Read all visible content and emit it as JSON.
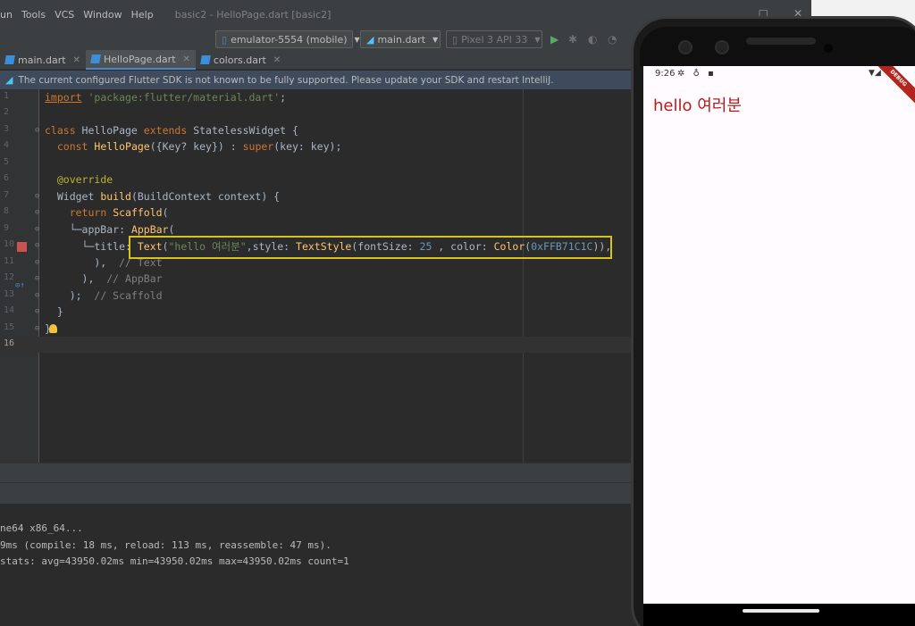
{
  "menubar": {
    "items": [
      "un",
      "Tools",
      "VCS",
      "Window",
      "Help"
    ],
    "title": "basic2 - HelloPage.dart [basic2]",
    "minimize_icon": "minimize-icon",
    "close_icon": "close-icon"
  },
  "toolbar": {
    "device_select": "emulator-5554 (mobile)",
    "config_select": "main.dart",
    "avd_select": "Pixel 3 API 33"
  },
  "tabs": [
    {
      "label": "main.dart"
    },
    {
      "label": "HelloPage.dart"
    },
    {
      "label": "colors.dart"
    }
  ],
  "banner": {
    "text": "The current configured Flutter SDK is not known to be fully supported. Please update your SDK and restart IntelliJ."
  },
  "editor": {
    "line_numbers": [
      "1",
      "2",
      "3",
      "4",
      "5",
      "6",
      "7",
      "8",
      "9",
      "10",
      "11",
      "12",
      "13",
      "14",
      "15",
      "16"
    ]
  },
  "console": {
    "lines": [
      "ne64 x86_64...",
      "9ms (compile: 18 ms, reload: 113 ms, reassemble: 47 ms).",
      "stats: avg=43950.02ms min=43950.02ms max=43950.02ms count=1"
    ]
  },
  "phone": {
    "time": "9:26",
    "debug_label": "DEBUG",
    "app_title": "hello 여러분",
    "title_color": "#B71C1C"
  }
}
